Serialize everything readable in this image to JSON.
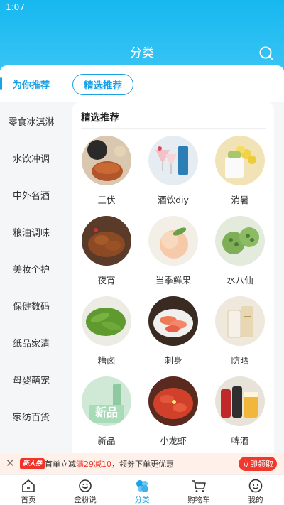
{
  "status": {
    "time": "1:07"
  },
  "header": {
    "title": "分类",
    "search_icon": "search-icon"
  },
  "sidebar": {
    "items": [
      {
        "label": "为你推荐",
        "active": true
      },
      {
        "label": "零食冰淇淋"
      },
      {
        "label": "水饮冲调"
      },
      {
        "label": "中外名酒"
      },
      {
        "label": "粮油调味"
      },
      {
        "label": "美妆个护"
      },
      {
        "label": "保健数码"
      },
      {
        "label": "纸品家清"
      },
      {
        "label": "母婴萌宠"
      },
      {
        "label": "家纺百货"
      }
    ]
  },
  "filter": {
    "pill_label": "精选推荐"
  },
  "section": {
    "title": "精选推荐",
    "items": [
      {
        "label": "三伏",
        "icon": "herbal-tea-photo"
      },
      {
        "label": "酒饮diy",
        "icon": "cocktail-photo"
      },
      {
        "label": "消暑",
        "icon": "summer-drink-photo"
      },
      {
        "label": "夜宵",
        "icon": "duck-neck-photo"
      },
      {
        "label": "当季鲜果",
        "icon": "peach-photo"
      },
      {
        "label": "水八仙",
        "icon": "lotus-seed-photo"
      },
      {
        "label": "糟卤",
        "icon": "edamame-photo"
      },
      {
        "label": "刺身",
        "icon": "sashimi-photo"
      },
      {
        "label": "防晒",
        "icon": "sunscreen-photo"
      },
      {
        "label": "新品",
        "icon": "new-product-photo",
        "overlay": "新品"
      },
      {
        "label": "小龙虾",
        "icon": "crayfish-photo"
      },
      {
        "label": "啤酒",
        "icon": "beer-photo"
      }
    ]
  },
  "promo": {
    "tag": "新人券",
    "text_before": "首单立减",
    "text_highlight": "满29减10",
    "text_after": "，领券下单更优惠",
    "button": "立即领取"
  },
  "tabbar": {
    "items": [
      {
        "label": "首页",
        "icon": "home-icon"
      },
      {
        "label": "盒粉说",
        "icon": "community-icon"
      },
      {
        "label": "分类",
        "icon": "category-icon",
        "active": true
      },
      {
        "label": "购物车",
        "icon": "cart-icon"
      },
      {
        "label": "我的",
        "icon": "profile-icon"
      }
    ]
  },
  "colors": {
    "accent": "#1aa1e6",
    "promo_red": "#ee3a2c"
  }
}
